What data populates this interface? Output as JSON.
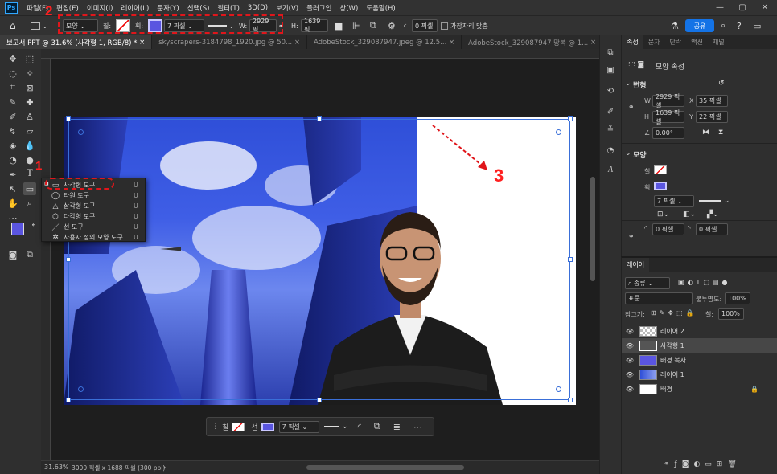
{
  "menu": {
    "app_icon": "Ps",
    "items": [
      "파일(F)",
      "편집(E)",
      "이미지(I)",
      "레이어(L)",
      "문자(Y)",
      "선택(S)",
      "필터(T)",
      "3D(D)",
      "보기(V)",
      "플러그인",
      "창(W)",
      "도움말(H)"
    ]
  },
  "options_bar": {
    "mode": "모양",
    "fill_label": "칠:",
    "stroke_label": "획:",
    "stroke_width": "7 픽셀",
    "w_label": "W:",
    "w_value": "2929 픽",
    "h_label": "H:",
    "h_value": "1639 픽",
    "corner_radius": "0 픽셀",
    "align_edges": "가장자리 맞춤",
    "share": "공유"
  },
  "annotations": {
    "step1": "1",
    "step2": "2",
    "step3": "3"
  },
  "tabs": [
    {
      "label": "보고서 PPT @ 31.6% (사각형 1, RGB/8) *",
      "active": true
    },
    {
      "label": "skyscrapers-3184798_1920.jpg @ 50...",
      "active": false
    },
    {
      "label": "AdobeStock_329087947.jpeg @ 12.5...",
      "active": false
    },
    {
      "label": "AdobeStock_329087947 망복 @ 1...",
      "active": false
    }
  ],
  "flyout": [
    {
      "icon": "rectangle-icon",
      "glyph": "▭",
      "label": "사각형 도구",
      "key": "U"
    },
    {
      "icon": "ellipse-icon",
      "glyph": "◯",
      "label": "타원 도구",
      "key": "U"
    },
    {
      "icon": "triangle-icon",
      "glyph": "△",
      "label": "삼각형 도구",
      "key": "U"
    },
    {
      "icon": "polygon-icon",
      "glyph": "⬡",
      "label": "다각형 도구",
      "key": "U"
    },
    {
      "icon": "line-icon",
      "glyph": "／",
      "label": "선 도구",
      "key": "U"
    },
    {
      "icon": "custom-shape-icon",
      "glyph": "✲",
      "label": "사용자 정의 모양 도구",
      "key": "U"
    }
  ],
  "context_bar": {
    "fill": "칠",
    "stroke": "선",
    "width": "7 픽셀"
  },
  "status": {
    "zoom": "31.63%",
    "size": "3000 픽셀 x 1688 픽셀 (300 ppi)"
  },
  "properties": {
    "tabs": [
      "속성",
      "문자",
      "단락",
      "액션",
      "채널"
    ],
    "shape_title": "모양 속성",
    "transform_title": "변형",
    "w": "2929 픽셀",
    "x": "35 픽셀",
    "h": "1639 픽셀",
    "y": "22 픽셀",
    "angle": "0.00°",
    "appearance_title": "모양",
    "fill_label": "칠",
    "stroke_label": "획",
    "stroke_width": "7 픽셀",
    "radius_tl": "0 픽셀",
    "radius_tr": "0 픽셀"
  },
  "layers_panel": {
    "title": "레이어",
    "filter": "종류",
    "blend": "표준",
    "opacity_label": "불투명도:",
    "opacity": "100%",
    "lock_label": "잠그기:",
    "fill_label": "칠:",
    "fill": "100%",
    "layers": [
      {
        "name": "레이어 2",
        "selected": false
      },
      {
        "name": "사각형 1",
        "selected": true
      },
      {
        "name": "배경 복사",
        "selected": false
      },
      {
        "name": "레이어 1",
        "selected": false
      },
      {
        "name": "배경",
        "selected": false
      }
    ]
  },
  "colors": {
    "accent": "#1473e6",
    "annotation": "#e0161b",
    "foreground": "#5a55e0",
    "background": "#000000"
  }
}
